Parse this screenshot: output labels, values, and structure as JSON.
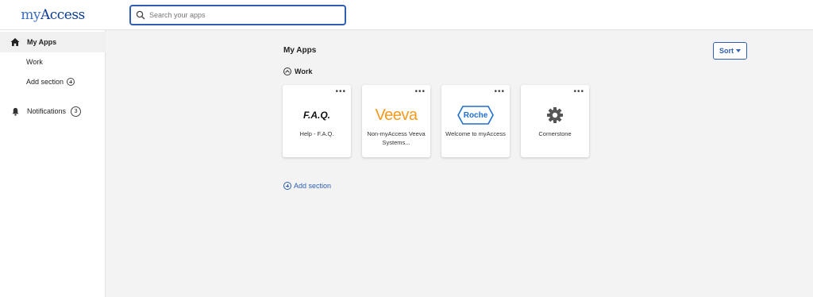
{
  "header": {
    "logo_my": "my",
    "logo_access": "Access",
    "search_placeholder": "Search your apps"
  },
  "sidebar": {
    "items": [
      {
        "label": "My Apps",
        "icon": "home-icon",
        "active": true
      },
      {
        "label": "Work"
      },
      {
        "label": "Add section",
        "icon": "add-circle-icon"
      },
      {
        "label": "Notifications",
        "icon": "bell-icon",
        "count": "3"
      }
    ]
  },
  "main": {
    "title": "My Apps",
    "sort_label": "Sort",
    "group": {
      "name": "Work"
    },
    "apps": [
      {
        "label": "Help - F.A.Q.",
        "logo_text": "F.A.Q.",
        "icon": "faq-logo"
      },
      {
        "label": "Non-myAccess Veeva Systems...",
        "logo_text": "Veeva",
        "icon": "veeva-logo"
      },
      {
        "label": "Welcome to myAccess",
        "logo_text": "Roche",
        "icon": "roche-logo"
      },
      {
        "label": "Cornerstone",
        "icon": "gear-icon"
      }
    ],
    "add_section_label": "Add section"
  },
  "colors": {
    "accent": "#2f5fb3",
    "veeva_orange": "#f29b1d",
    "roche_blue": "#1f6fd0",
    "gear_gray": "#555555"
  }
}
